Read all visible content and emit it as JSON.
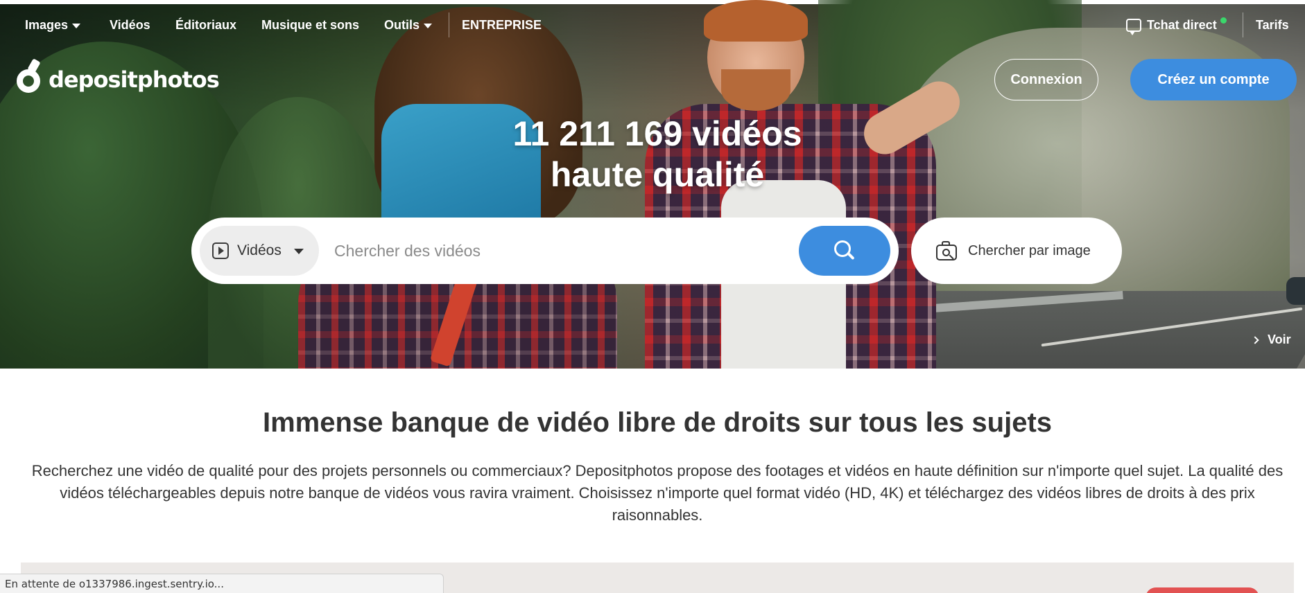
{
  "topnav": {
    "items": [
      {
        "label": "Images",
        "has_dropdown": true
      },
      {
        "label": "Vidéos",
        "has_dropdown": false
      },
      {
        "label": "Éditoriaux",
        "has_dropdown": false
      },
      {
        "label": "Musique et sons",
        "has_dropdown": false
      },
      {
        "label": "Outils",
        "has_dropdown": true
      },
      {
        "label": "ENTREPRISE",
        "has_dropdown": false
      }
    ],
    "chat_label": "Tchat direct",
    "pricing_label": "Tarifs"
  },
  "brand": {
    "logo_text": "depositphotos"
  },
  "auth": {
    "login_label": "Connexion",
    "signup_label": "Créez un compte"
  },
  "hero": {
    "headline_line1": "11 211 169 vidéos",
    "headline_line2": "haute qualité",
    "more_label": "Voir"
  },
  "search": {
    "type_selected": "Vidéos",
    "placeholder": "Chercher des vidéos",
    "value": "",
    "image_search_label": "Chercher par image",
    "submit_icon": "search-icon"
  },
  "content": {
    "title": "Immense banque de vidéo libre de droits sur tous les sujets",
    "paragraph": "Recherchez une vidéo de qualité pour des projets personnels ou commerciaux? Depositphotos propose des footages et vidéos en haute définition sur n'importe quel sujet. La qualité des vidéos téléchargeables depuis notre banque de vidéos vous ravira vraiment. Choisissez n'importe quel format vidéo (HD, 4K) et téléchargez des vidéos libres de droits à des prix raisonnables."
  },
  "browser_status": {
    "text": "En attente de o1337986.ingest.sentry.io..."
  },
  "colors": {
    "accent": "#3d8ddf",
    "online": "#3ad86b",
    "text": "#333333"
  },
  "icons": [
    "chevron-down-icon",
    "chat-icon",
    "play-icon",
    "search-icon",
    "camera-search-icon",
    "chevron-right-icon"
  ]
}
